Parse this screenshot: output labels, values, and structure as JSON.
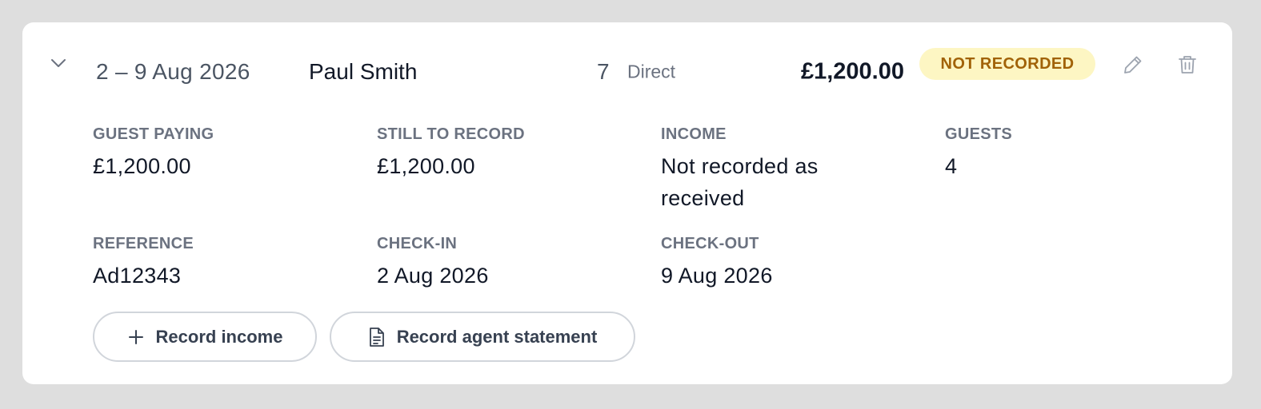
{
  "booking": {
    "dates": "2 – 9 Aug 2026",
    "guest_name": "Paul Smith",
    "nights": "7",
    "channel": "Direct",
    "amount": "£1,200.00",
    "status": "NOT RECORDED",
    "status_color": "#fdf6c3",
    "status_text_color": "#a16207"
  },
  "icons": {
    "expand": "chevron-down-icon",
    "edit": "pencil-icon",
    "delete": "trash-icon",
    "record_income": "plus-icon",
    "record_agent_statement": "document-icon"
  },
  "details": {
    "guest_paying": {
      "label": "GUEST PAYING",
      "value": "£1,200.00"
    },
    "still_to_record": {
      "label": "STILL TO RECORD",
      "value": "£1,200.00"
    },
    "income": {
      "label": "INCOME",
      "value": "Not recorded as received"
    },
    "guests": {
      "label": "GUESTS",
      "value": "4"
    },
    "reference": {
      "label": "REFERENCE",
      "value": "Ad12343"
    },
    "check_in": {
      "label": "CHECK-IN",
      "value": "2 Aug 2026"
    },
    "check_out": {
      "label": "CHECK-OUT",
      "value": "9 Aug 2026"
    }
  },
  "actions": {
    "record_income": "Record income",
    "record_agent_statement": "Record agent statement"
  }
}
